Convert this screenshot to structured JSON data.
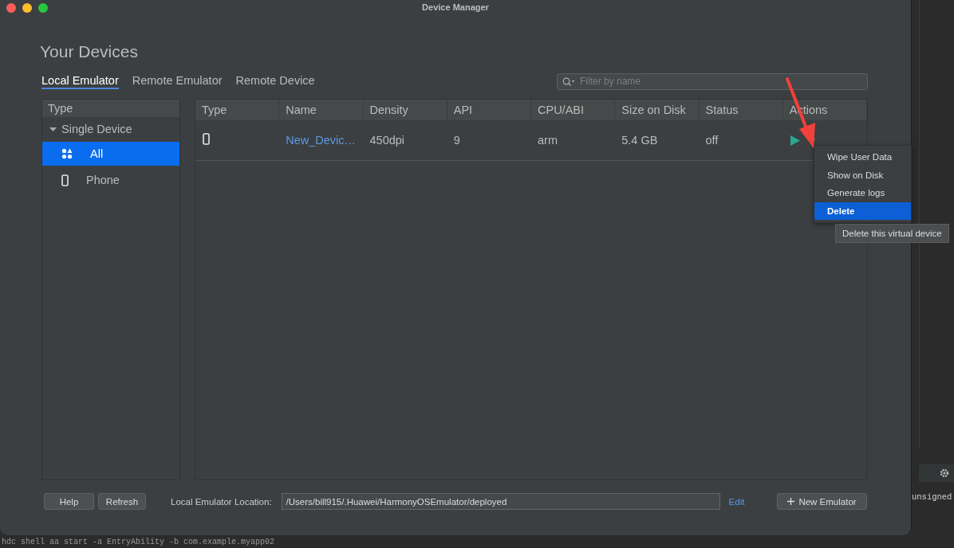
{
  "window": {
    "title": "Device Manager"
  },
  "heading": "Your Devices",
  "tabs": [
    {
      "label": "Local Emulator",
      "selected": true
    },
    {
      "label": "Remote Emulator",
      "selected": false
    },
    {
      "label": "Remote Device",
      "selected": false
    }
  ],
  "search": {
    "placeholder": "Filter by name"
  },
  "sidebar": {
    "header": "Type",
    "group": {
      "label": "Single Device",
      "expanded": true,
      "items": [
        {
          "label": "All",
          "kind": "all",
          "selected": true
        },
        {
          "label": "Phone",
          "kind": "phone",
          "selected": false
        }
      ]
    }
  },
  "table": {
    "columns": [
      "Type",
      "Name",
      "Density",
      "API",
      "CPU/ABI",
      "Size on Disk",
      "Status",
      "Actions"
    ],
    "rows": [
      {
        "kind": "phone",
        "name": "New_Devic…",
        "density": "450dpi",
        "api": "9",
        "cpu_abi": "arm",
        "size": "5.4 GB",
        "status": "off"
      }
    ]
  },
  "context_menu": {
    "items": [
      {
        "label": "Wipe User Data",
        "selected": false
      },
      {
        "label": "Show on Disk",
        "selected": false
      },
      {
        "label": "Generate logs",
        "selected": false
      },
      {
        "label": "Delete",
        "selected": true
      }
    ]
  },
  "tooltip": "Delete this virtual device",
  "footer": {
    "buttons": [
      "Help",
      "Refresh"
    ],
    "location_label": "Local Emulator Location:",
    "location_value": "/Users/bill915/.Huawei/HarmonyOSEmulator/deployed",
    "edit_link": "Edit",
    "new_button": "New Emulator"
  },
  "background": {
    "terminal_line": "hdc shell aa start -a EntryAbility -b com.example.myapp02",
    "side_text": "unsigned"
  }
}
